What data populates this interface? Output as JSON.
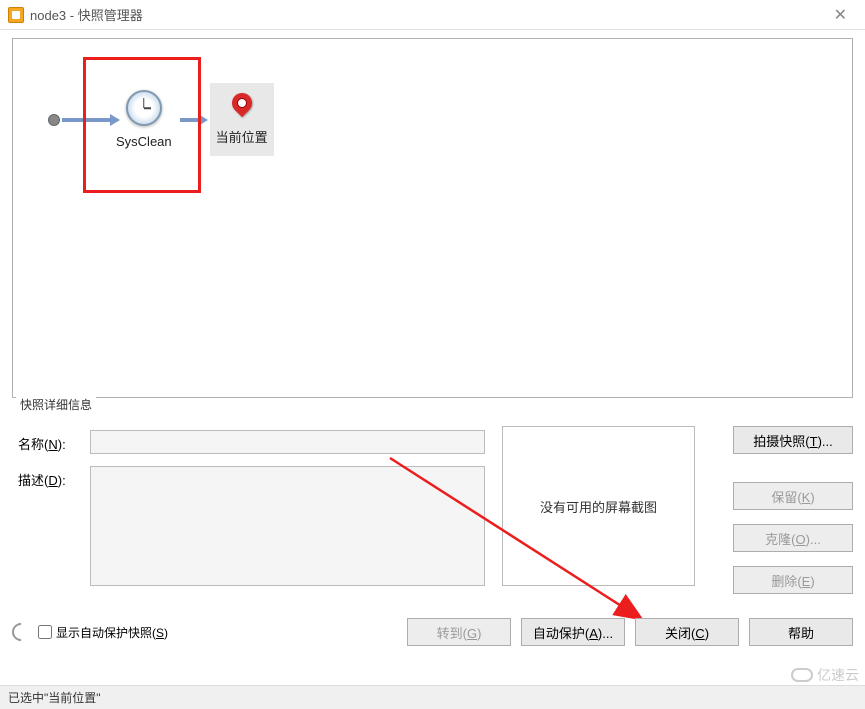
{
  "title": "node3 - 快照管理器",
  "tree": {
    "snapshot_label": "SysClean",
    "here_label": "当前位置"
  },
  "details": {
    "legend": "快照详细信息",
    "name_label": "名称(N):",
    "desc_label": "描述(D):",
    "name_value": "",
    "desc_value": "",
    "preview_text": "没有可用的屏幕截图"
  },
  "buttons": {
    "take": "拍摄快照(T)...",
    "keep": "保留(K)",
    "clone": "克隆(O)...",
    "delete": "删除(E)",
    "goto": "转到(G)",
    "autoprotect": "自动保护(A)...",
    "close": "关闭(C)",
    "help": "帮助"
  },
  "auto_chk_label": "显示自动保护快照(S)",
  "status": "已选中\"当前位置\"",
  "watermark": "亿速云"
}
